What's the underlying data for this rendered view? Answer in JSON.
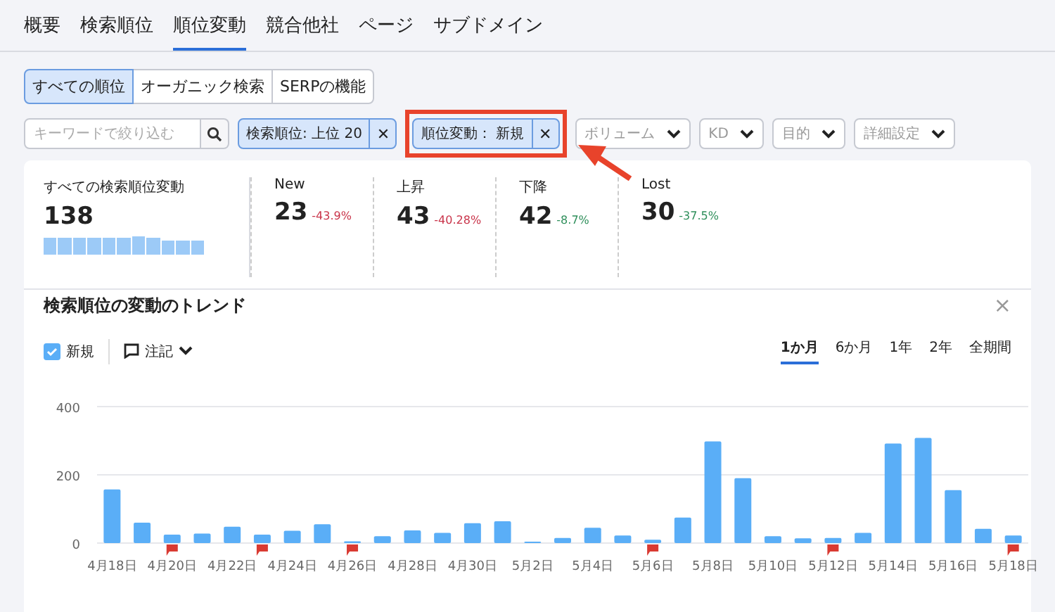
{
  "tabs": [
    {
      "label": "概要",
      "selected": false
    },
    {
      "label": "検索順位",
      "selected": false
    },
    {
      "label": "順位変動",
      "selected": true
    },
    {
      "label": "競合他社",
      "selected": false
    },
    {
      "label": "ページ",
      "selected": false
    },
    {
      "label": "サブドメイン",
      "selected": false
    }
  ],
  "segments": [
    {
      "label": "すべての順位",
      "selected": true
    },
    {
      "label": "オーガニック検索",
      "selected": false
    },
    {
      "label": "SERPの機能",
      "selected": false
    }
  ],
  "search": {
    "placeholder": "キーワードで絞り込む"
  },
  "filters": [
    {
      "kind": "chip",
      "label": "検索順位: 上位 20",
      "remove": "✕",
      "highlighted": false
    },
    {
      "kind": "chip",
      "label": "順位変動： 新規",
      "remove": "✕",
      "highlighted": true
    },
    {
      "kind": "dropdown",
      "label": "ボリューム"
    },
    {
      "kind": "dropdown",
      "label": "KD"
    },
    {
      "kind": "dropdown",
      "label": "目的"
    },
    {
      "kind": "dropdown",
      "label": "詳細設定"
    }
  ],
  "summary": {
    "total": {
      "label": "すべての検索順位変動",
      "value": "138"
    },
    "metrics": [
      {
        "label": "New",
        "value": "23",
        "delta": "-43.9%",
        "color": "#c9344a"
      },
      {
        "label": "上昇",
        "value": "43",
        "delta": "-40.28%",
        "color": "#c9344a"
      },
      {
        "label": "下降",
        "value": "42",
        "delta": "-8.7%",
        "color": "#2f8f5b"
      },
      {
        "label": "Lost",
        "value": "30",
        "delta": "-37.5%",
        "color": "#2f8f5b"
      }
    ]
  },
  "trend": {
    "title": "検索順位の変動のトレンド",
    "close": "×",
    "legend": {
      "checked": true
    },
    "notes": {
      "label": "注記"
    },
    "periods": [
      {
        "label": "1か月",
        "selected": true
      },
      {
        "label": "6か月",
        "selected": false
      },
      {
        "label": "1年",
        "selected": false
      },
      {
        "label": "2年",
        "selected": false
      },
      {
        "label": "全期間",
        "selected": false
      }
    ],
    "chart_data": {
      "type": "bar",
      "ylim": [
        0,
        400
      ],
      "yticks": [
        0,
        200,
        400
      ],
      "categories": [
        "4月18日",
        null,
        "4月20日",
        null,
        "4月22日",
        null,
        "4月24日",
        null,
        "4月26日",
        null,
        "4月28日",
        null,
        "4月30日",
        null,
        "5月2日",
        null,
        "5月4日",
        null,
        "5月6日",
        null,
        "5月8日",
        null,
        "5月10日",
        null,
        "5月12日",
        null,
        "5月14日",
        null,
        "5月16日",
        null,
        "5月18日"
      ],
      "series": [
        {
          "name": "新規",
          "color": "#5aaef7",
          "values": [
            157,
            60,
            25,
            28,
            48,
            25,
            36,
            55,
            5,
            20,
            37,
            30,
            58,
            64,
            4,
            15,
            45,
            22,
            10,
            75,
            298,
            190,
            20,
            14,
            15,
            30,
            292,
            308,
            155,
            42,
            22
          ]
        }
      ]
    },
    "note_markers": [
      {
        "flagged": false
      },
      {
        "flagged": false
      },
      {
        "flagged": true
      },
      {
        "flagged": false
      },
      {
        "flagged": false
      },
      {
        "flagged": true
      },
      {
        "flagged": false
      },
      {
        "flagged": false
      },
      {
        "flagged": true
      },
      {
        "flagged": false
      },
      {
        "flagged": false
      },
      {
        "flagged": false
      },
      {
        "flagged": false
      },
      {
        "flagged": false
      },
      {
        "flagged": false
      },
      {
        "flagged": false
      },
      {
        "flagged": false
      },
      {
        "flagged": false
      },
      {
        "flagged": true
      },
      {
        "flagged": false
      },
      {
        "flagged": false
      },
      {
        "flagged": false
      },
      {
        "flagged": false
      },
      {
        "flagged": false
      },
      {
        "flagged": true
      },
      {
        "flagged": false
      },
      {
        "flagged": false
      },
      {
        "flagged": false
      },
      {
        "flagged": false
      },
      {
        "flagged": false
      },
      {
        "flagged": true
      }
    ]
  }
}
